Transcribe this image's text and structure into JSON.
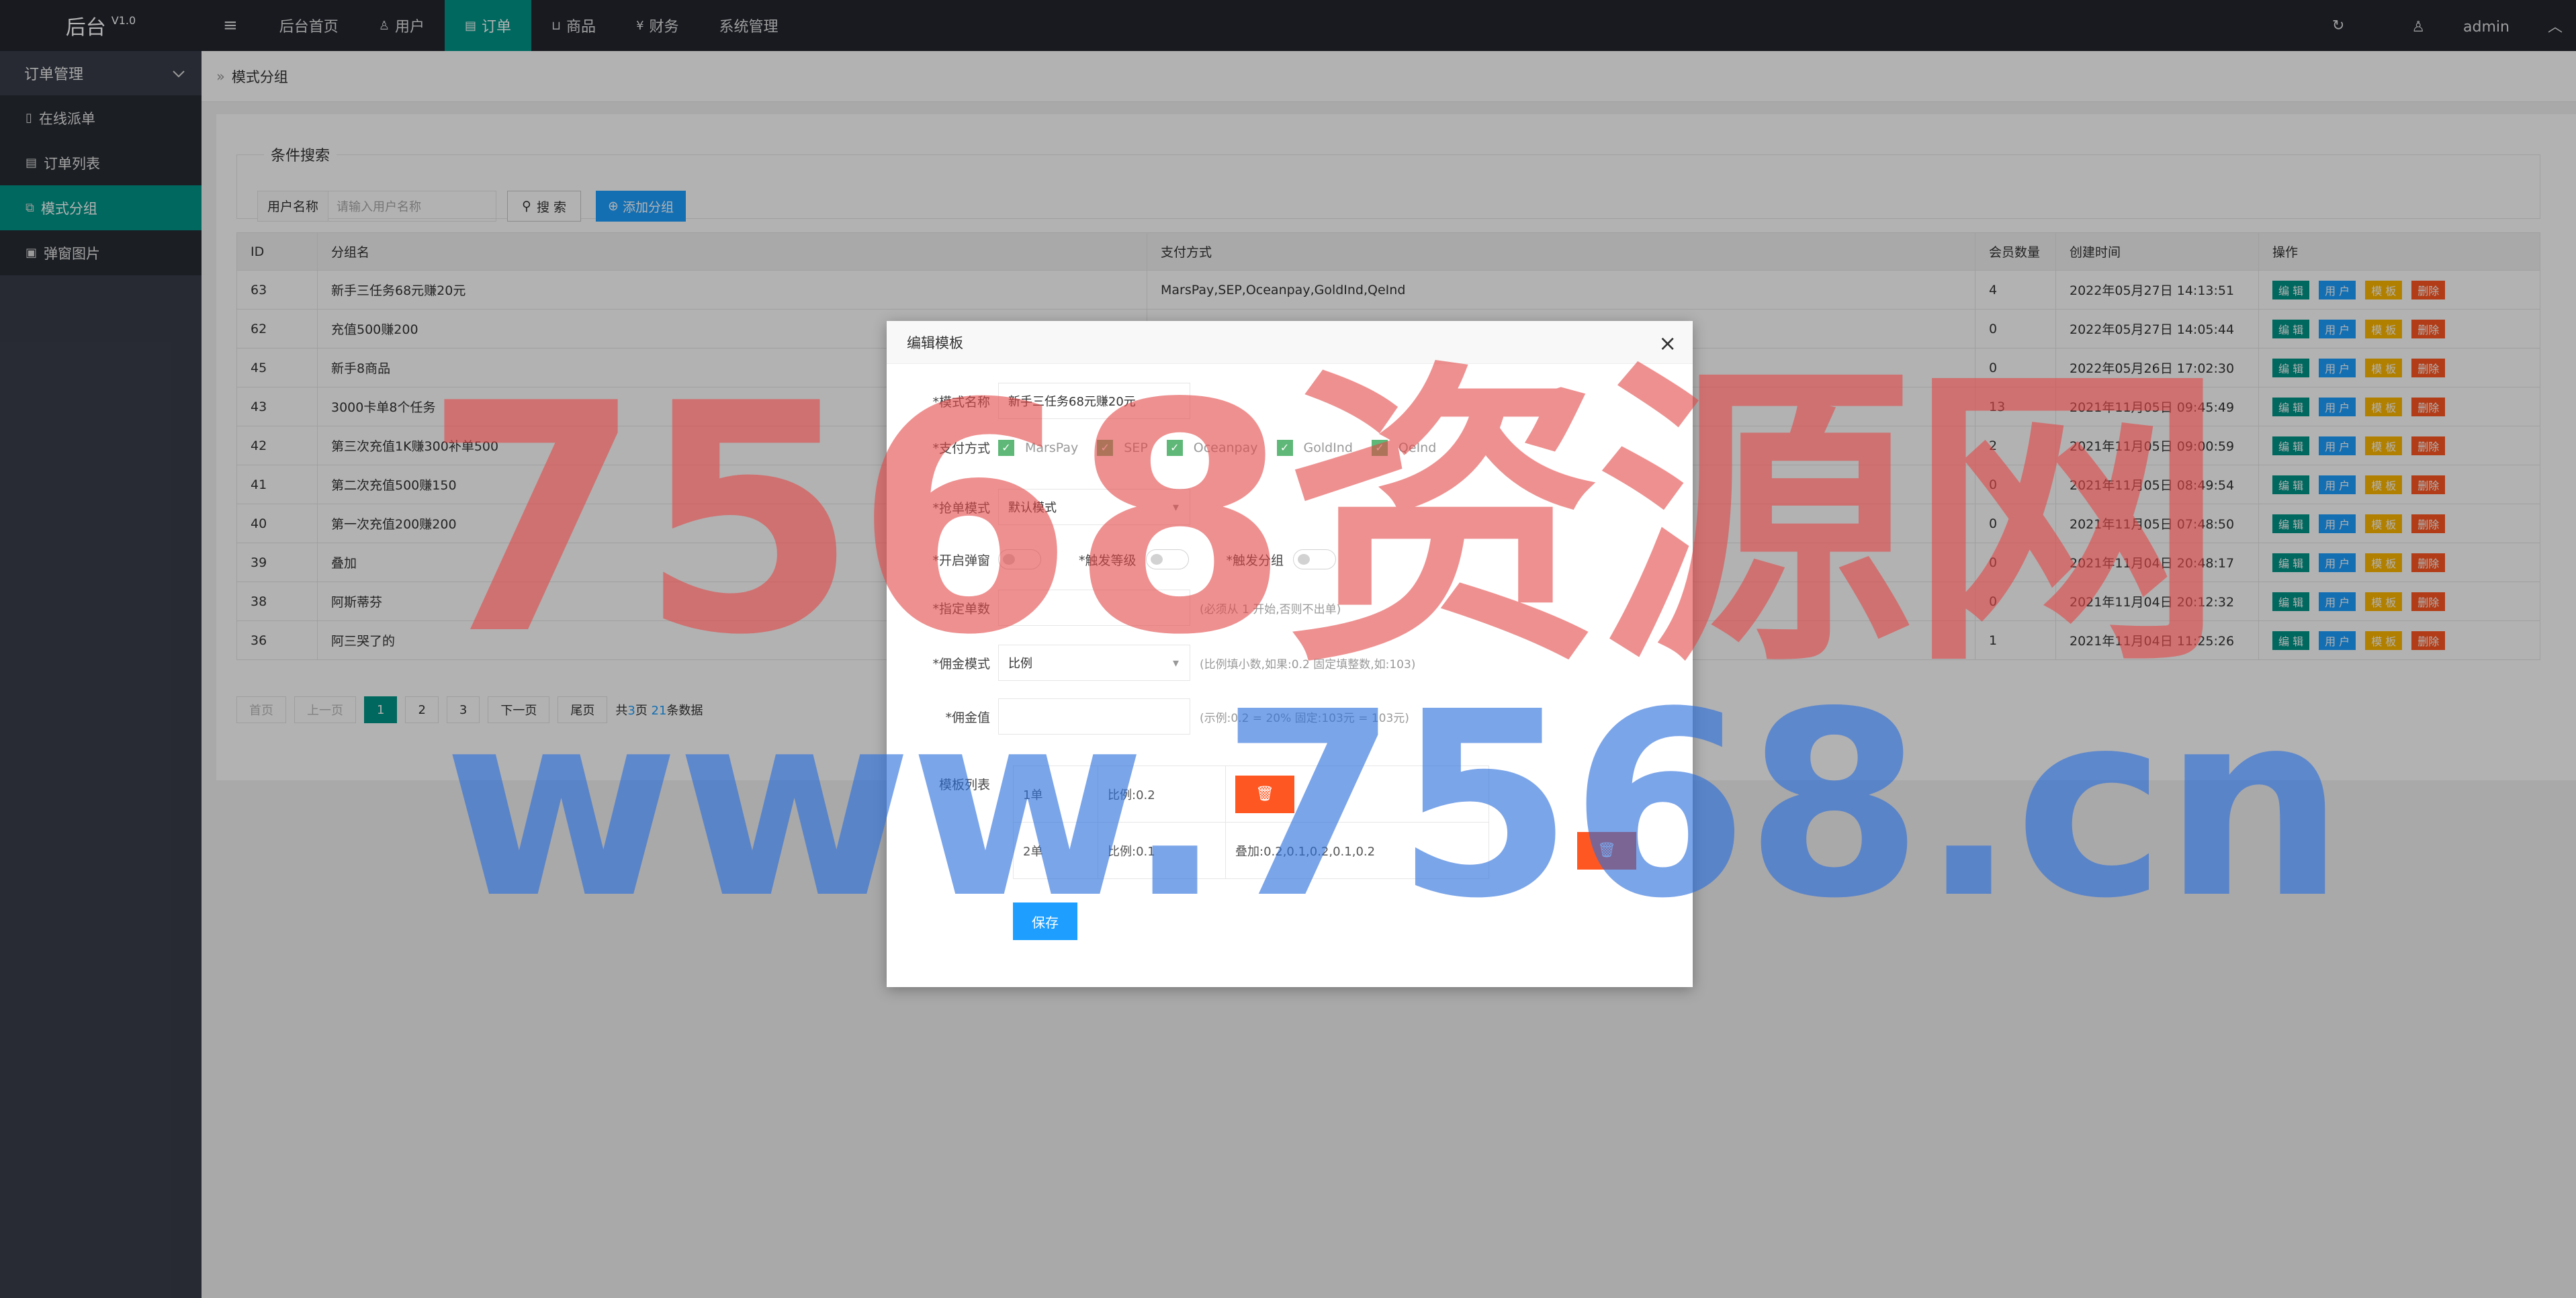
{
  "app": {
    "title": "后台",
    "version": "V1.0"
  },
  "header": {
    "menu_icon": "hamburger-icon",
    "nav": [
      {
        "label": "后台首页",
        "icon": ""
      },
      {
        "label": "用户",
        "icon": "user-icon"
      },
      {
        "label": "订单",
        "icon": "order-icon",
        "active": true
      },
      {
        "label": "商品",
        "icon": "cart-icon"
      },
      {
        "label": "财务",
        "icon": "yen-icon"
      },
      {
        "label": "系统管理",
        "icon": ""
      }
    ],
    "refresh_icon": "refresh-icon",
    "user": "admin"
  },
  "sidebar": {
    "group": "订单管理",
    "items": [
      {
        "label": "在线派单",
        "icon": "doc-icon"
      },
      {
        "label": "订单列表",
        "icon": "list-icon"
      },
      {
        "label": "模式分组",
        "icon": "group-icon",
        "active": true
      },
      {
        "label": "弹窗图片",
        "icon": "image-icon"
      }
    ]
  },
  "breadcrumb": "模式分组",
  "search": {
    "legend": "条件搜索",
    "label": "用户名称",
    "placeholder": "请输入用户名称",
    "search_btn": "搜 索",
    "add_btn": "添加分组"
  },
  "table": {
    "headers": [
      "ID",
      "分组名",
      "支付方式",
      "会员数量",
      "创建时间",
      "操作"
    ],
    "rows": [
      {
        "id": "63",
        "name": "新手三任务68元赚20元",
        "pay": "MarsPay,SEP,Oceanpay,GoldInd,QeInd",
        "members": "4",
        "time": "2022年05月27日 14:13:51"
      },
      {
        "id": "62",
        "name": "充值500赚200",
        "pay": "",
        "members": "0",
        "time": "2022年05月27日 14:05:44"
      },
      {
        "id": "45",
        "name": "新手8商品",
        "pay": "",
        "members": "0",
        "time": "2022年05月26日 17:02:30"
      },
      {
        "id": "43",
        "name": "3000卡单8个任务",
        "pay": "",
        "members": "13",
        "time": "2021年11月05日 09:45:49"
      },
      {
        "id": "42",
        "name": "第三次充值1K赚300补单500",
        "pay": "",
        "members": "2",
        "time": "2021年11月05日 09:00:59"
      },
      {
        "id": "41",
        "name": "第二次充值500赚150",
        "pay": "",
        "members": "0",
        "time": "2021年11月05日 08:49:54"
      },
      {
        "id": "40",
        "name": "第一次充值200赚200",
        "pay": "",
        "members": "0",
        "time": "2021年11月05日 07:48:50"
      },
      {
        "id": "39",
        "name": "叠加",
        "pay": "",
        "members": "0",
        "time": "2021年11月04日 20:48:17"
      },
      {
        "id": "38",
        "name": "阿斯蒂芬",
        "pay": "",
        "members": "0",
        "time": "2021年11月04日 20:12:32"
      },
      {
        "id": "36",
        "name": "阿三哭了的",
        "pay": "",
        "members": "1",
        "time": "2021年11月04日 11:25:26"
      }
    ],
    "ops": {
      "edit": "编 辑",
      "user": "用 户",
      "tpl": "模 板",
      "del": "删除"
    }
  },
  "pager": {
    "first": "首页",
    "prev": "上一页",
    "pages": [
      "1",
      "2",
      "3"
    ],
    "next": "下一页",
    "last": "尾页",
    "info_prefix": "共",
    "total_pages": "3",
    "info_mid": "页 ",
    "total_rows": "21",
    "info_suffix": "条数据"
  },
  "modal": {
    "title": "编辑模板",
    "close_icon": "close-icon",
    "name_label": "*模式名称",
    "name_value": "新手三任务68元赚20元",
    "pay_label": "*支付方式",
    "pay_options": [
      "MarsPay",
      "SEP",
      "Oceanpay",
      "GoldInd",
      "QeInd"
    ],
    "grab_label": "*抢单模式",
    "grab_value": "默认模式",
    "popup_label": "*开启弹窗",
    "level_label": "*触发等级",
    "group_label": "*触发分组",
    "orders_label": "*指定单数",
    "orders_tip": "(必须从 1 开始,否则不出单)",
    "comm_mode_label": "*佣金模式",
    "comm_mode_value": "比例",
    "comm_mode_tip": "(比例填小数,如果:0.2 固定填整数,如:103)",
    "comm_value_label": "*佣金值",
    "comm_value_tip": "(示例:0.2 = 20% 固定:103元 = 103元)",
    "tpl_label": "模板列表",
    "tpl_rows": [
      {
        "order": "1单",
        "ratio": "比例:0.2",
        "extra": ""
      },
      {
        "order": "2单",
        "ratio": "比例:0.1",
        "extra": "叠加:0.2,0.1,0.2,0.1,0.2"
      }
    ],
    "save_btn": "保存"
  },
  "watermark": {
    "line1": "7568资源网",
    "line2": "www.7568.cn"
  }
}
